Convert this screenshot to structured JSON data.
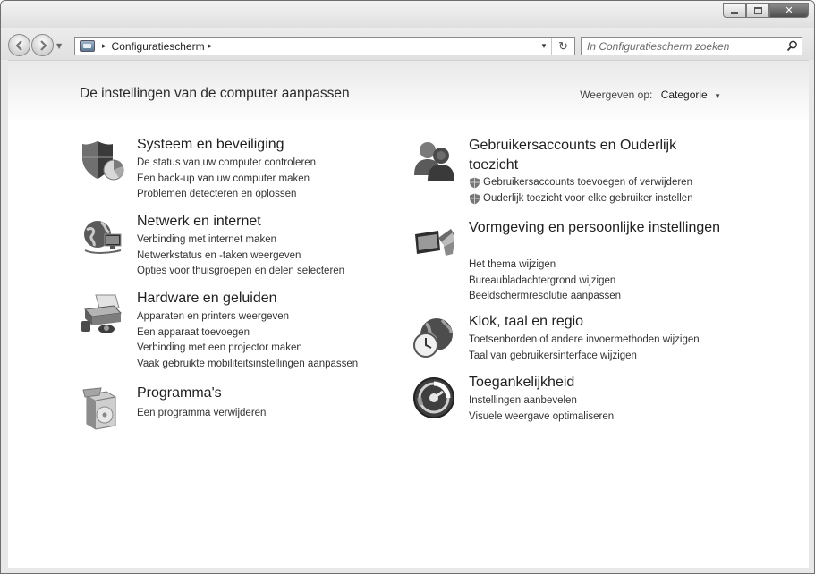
{
  "window": {
    "controls": {
      "minimize": "—",
      "maximize": "□",
      "close": "✕"
    }
  },
  "address_bar": {
    "breadcrumb": "Configuratiescherm",
    "separator": "▸",
    "dropdown": "▾",
    "refresh": "↻"
  },
  "search": {
    "placeholder": "In Configuratiescherm zoeken"
  },
  "page": {
    "heading": "De instellingen van de computer aanpassen",
    "view_by_label": "Weergeven op:",
    "view_by_value": "Categorie",
    "view_by_caret": "▼"
  },
  "categories": [
    {
      "title": "Systeem en beveiliging",
      "icon": "security-shield-icon",
      "links": [
        "De status van uw computer controleren",
        "Een back-up van uw computer maken",
        "Problemen detecteren en oplossen"
      ]
    },
    {
      "title": "Netwerk en internet",
      "icon": "network-globe-icon",
      "links": [
        "Verbinding met internet maken",
        "Netwerkstatus en -taken weergeven",
        "Opties voor thuisgroepen en delen selecteren"
      ]
    },
    {
      "title": "Hardware en geluiden",
      "icon": "printer-hardware-icon",
      "links": [
        "Apparaten en printers weergeven",
        "Een apparaat toevoegen",
        "Verbinding met een projector maken",
        "Vaak gebruikte mobiliteitsinstellingen aanpassen"
      ]
    },
    {
      "title": "Programma's",
      "icon": "programs-box-icon",
      "links": [
        "Een programma verwijderen"
      ]
    },
    {
      "title": "Gebruikersaccounts en Ouderlijk toezicht",
      "icon": "user-accounts-icon",
      "links": [
        "Gebruikersaccounts toevoegen of verwijderen",
        "Ouderlijk toezicht voor elke gebruiker instellen"
      ]
    },
    {
      "title": "Vormgeving en persoonlijke instellingen",
      "icon": "appearance-personalization-icon",
      "links": [
        "Het thema wijzigen",
        "Bureaubladachtergrond wijzigen",
        "Beeldschermresolutie aanpassen"
      ]
    },
    {
      "title": "Klok, taal en regio",
      "icon": "clock-globe-icon",
      "links": [
        "Toetsenborden of andere invoermethoden wijzigen",
        "Taal van gebruikersinterface wijzigen"
      ]
    },
    {
      "title": "Toegankelijkheid",
      "icon": "ease-of-access-icon",
      "links": [
        "Instellingen aanbevelen",
        "Visuele weergave optimaliseren"
      ]
    }
  ]
}
